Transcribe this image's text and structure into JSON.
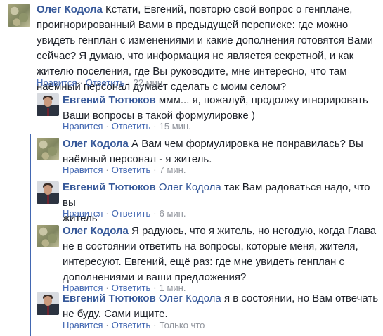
{
  "comments": [
    {
      "author": "Олег Кодола",
      "mention": "",
      "text_lines": [
        "Кстати, Евгений, повторю свой вопрос о генплане,",
        "проигнорированный Вами в предыдущей переписке: где можно",
        "увидеть генплан с изменениями и какие дополнения готовятся Вами",
        "сейчас? Я думаю, что информация не является секретной, и как",
        "жителю поселения, где Вы руководите, мне интересно, что там",
        "наёмный персонал думает сделать с моим селом?"
      ],
      "like": "Нравится",
      "reply": "Ответить",
      "time": "22 мин."
    },
    {
      "author": "Евгений Тютюков",
      "mention": "",
      "text_lines": [
        "ммм... я, пожалуй, продолжу игнорировать",
        "Ваши вопросы в такой формулировке )"
      ],
      "like": "Нравится",
      "reply": "Ответить",
      "time": "15 мин."
    },
    {
      "author": "Олег Кодола",
      "mention": "",
      "text_lines": [
        "А Вам чем формулировка не понравилась? Вы",
        "наёмный персонал - я житель."
      ],
      "like": "Нравится",
      "reply": "Ответить",
      "time": "7 мин."
    },
    {
      "author": "Евгений Тютюков",
      "mention": "Олег Кодола",
      "text_lines": [
        "так Вам радоваться надо, что вы",
        "житель"
      ],
      "like": "Нравится",
      "reply": "Ответить",
      "time": "6 мин."
    },
    {
      "author": "Олег Кодола",
      "mention": "",
      "text_lines": [
        "Я радуюсь, что я житель, но негодую, когда Глава",
        "не в состоянии ответить на вопросы, которые меня, жителя,",
        "интересуют. Евгений, ещё раз: где мне увидеть генплан с",
        "дополнениями и ваши предложения?"
      ],
      "like": "Нравится",
      "reply": "Ответить",
      "time": "1 мин."
    },
    {
      "author": "Евгений Тютюков",
      "mention": "Олег Кодола",
      "text_lines": [
        "я в состоянии, но Вам отвечать",
        "не буду. Сами ищите."
      ],
      "like": "Нравится",
      "reply": "Ответить",
      "time": "Только что"
    }
  ]
}
